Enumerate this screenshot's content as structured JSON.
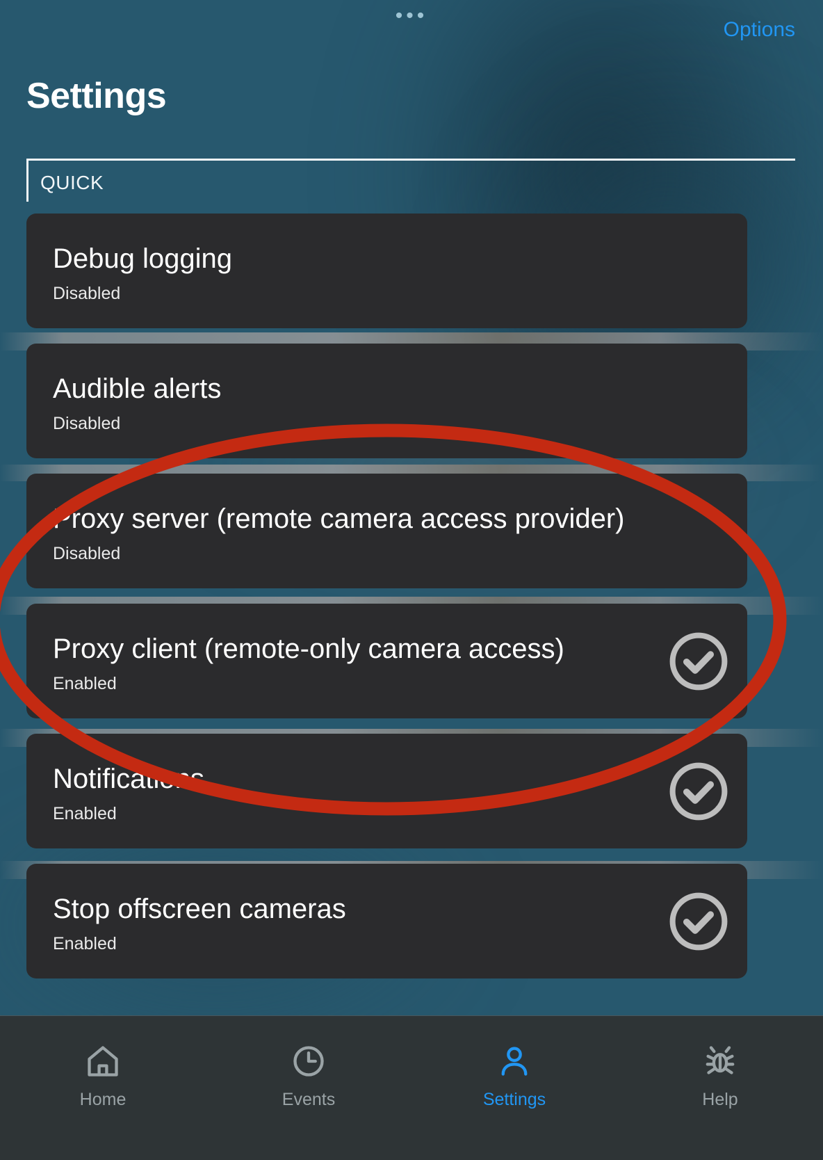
{
  "header": {
    "menu_icon": "more-horizontal-icon",
    "options_label": "Options",
    "title": "Settings"
  },
  "tabs": [
    {
      "label": "QUICK",
      "selected": true
    }
  ],
  "colors": {
    "background": "#27586e",
    "card": "#2b2b2d",
    "accent_blue": "#2196f3",
    "annotation_red": "#c42a12",
    "check_gray": "#bdbdbd",
    "navbar": "#2e3436"
  },
  "settings_list": [
    {
      "title": "Debug logging",
      "status": "Disabled",
      "checked": false
    },
    {
      "title": "Audible alerts",
      "status": "Disabled",
      "checked": false
    },
    {
      "title": "Proxy server (remote camera access provider)",
      "status": "Disabled",
      "checked": false
    },
    {
      "title": "Proxy client (remote-only camera access)",
      "status": "Enabled",
      "checked": true
    },
    {
      "title": "Notifications",
      "status": "Enabled",
      "checked": true
    },
    {
      "title": "Stop offscreen cameras",
      "status": "Enabled",
      "checked": true
    }
  ],
  "annotation": {
    "shape": "ellipse",
    "color": "#c42a12",
    "stroke_width": 18,
    "highlights": [
      "Proxy server (remote camera access provider)",
      "Proxy client (remote-only camera access)"
    ]
  },
  "bottom_nav": [
    {
      "label": "Home",
      "icon": "home-icon",
      "active": false
    },
    {
      "label": "Events",
      "icon": "clock-icon",
      "active": false
    },
    {
      "label": "Settings",
      "icon": "person-icon",
      "active": true
    },
    {
      "label": "Help",
      "icon": "bug-icon",
      "active": false
    }
  ]
}
